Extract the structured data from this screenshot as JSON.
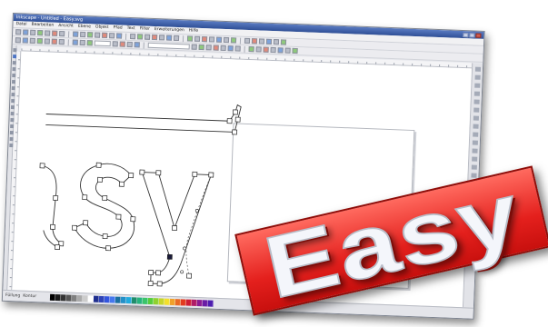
{
  "window": {
    "title": "Inkscape - Untitled - Easy.svg"
  },
  "menubar": {
    "items": [
      "Datei",
      "Bearbeiten",
      "Ansicht",
      "Ebene",
      "Objekt",
      "Pfad",
      "Text",
      "Filter",
      "Erweiterungen",
      "Hilfe"
    ]
  },
  "toolbars": {
    "main_icon_count": 34,
    "controls_icon_count": 28
  },
  "canvas": {
    "artwork_text": "asy",
    "node_tool_active": true
  },
  "statusbar": {
    "fill_label": "Füllung",
    "stroke_label": "Kontur"
  },
  "palette": {
    "colors": [
      "#000000",
      "#1a1a1a",
      "#333333",
      "#555555",
      "#808080",
      "#aaaaaa",
      "#cccccc",
      "#ffffff",
      "#1f2f8f",
      "#2e43b8",
      "#3355dd",
      "#4477ee",
      "#1a6fa0",
      "#2390c8",
      "#22aadd",
      "#1f8d6b",
      "#27b37d",
      "#39c46a",
      "#56cc3c",
      "#8fd12f",
      "#c7d52a",
      "#f3df2b",
      "#f0a12a",
      "#ea6a24",
      "#e23b1f",
      "#cf1d35",
      "#b01c67",
      "#8b1c92",
      "#6a1ca6",
      "#4d1eaf"
    ]
  },
  "stamp": {
    "text": "Easy",
    "color": "#e4201d"
  },
  "colors": {
    "accent": "#2f4f96",
    "node_handle": "#ffffff",
    "node_selected": "#1a1a3a"
  }
}
